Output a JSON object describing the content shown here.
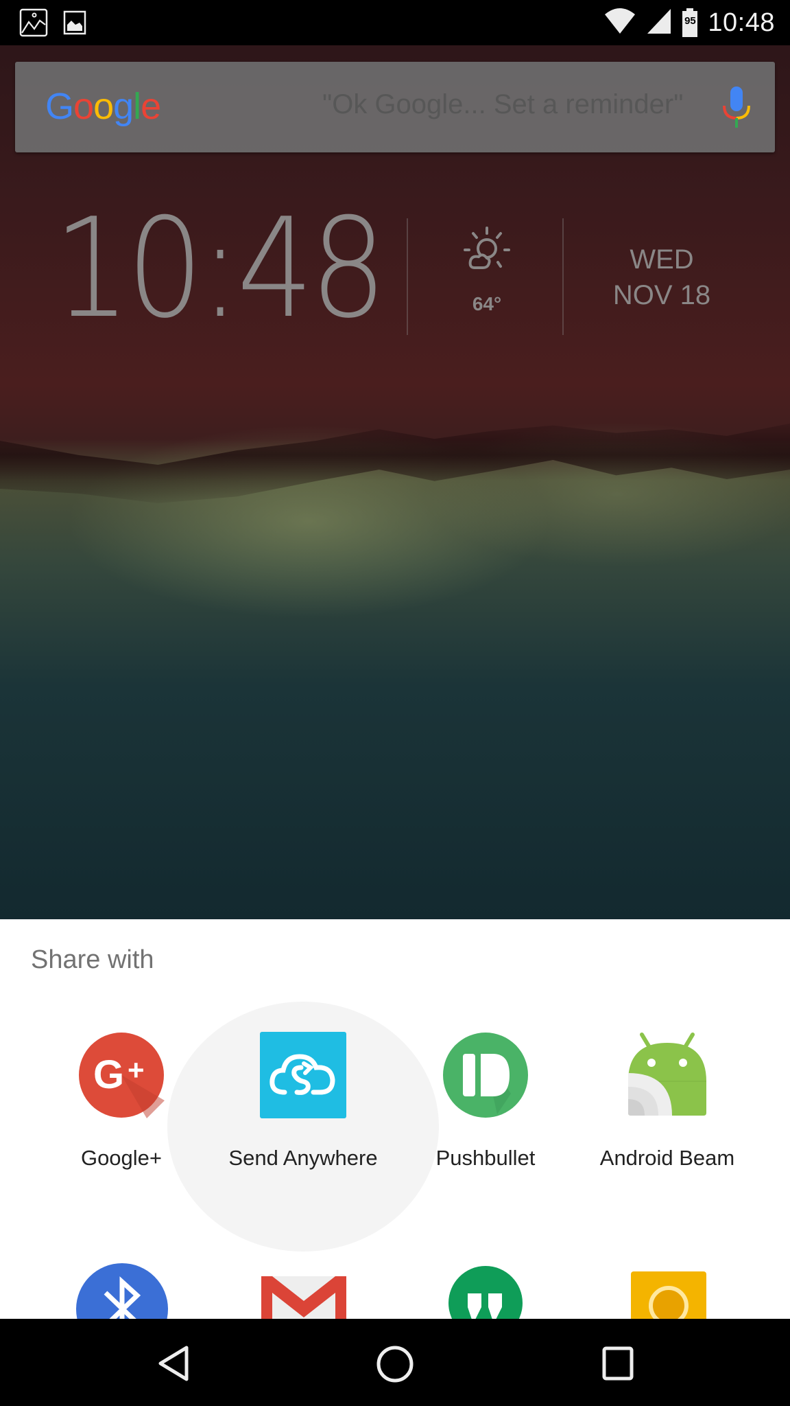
{
  "status_bar": {
    "left_icons": [
      "gallery-notification-icon",
      "image-notification-icon"
    ],
    "wifi_icon": "wifi-icon",
    "signal_icon": "cell-signal-icon",
    "battery_level": "95",
    "time": "10:48"
  },
  "search_widget": {
    "logo": "Google",
    "logo_colors": [
      "#4285F4",
      "#EA4335",
      "#FBBC05",
      "#4285F4",
      "#34A853",
      "#EA4335"
    ],
    "hint": "\"Ok Google... Set a reminder\"",
    "mic_icon": "microphone-icon"
  },
  "clock_widget": {
    "time": "10:48",
    "weather_icon": "partly-sunny-icon",
    "temperature": "64°",
    "day": "WED",
    "date": "NOV 18"
  },
  "share_sheet": {
    "title": "Share with",
    "apps": [
      {
        "label": "Google+",
        "icon": "google-plus-icon",
        "color": "#DD4B39"
      },
      {
        "label": "Send Anywhere",
        "icon": "send-anywhere-icon",
        "color": "#1FBDE3"
      },
      {
        "label": "Pushbullet",
        "icon": "pushbullet-icon",
        "color": "#4AB367"
      },
      {
        "label": "Android Beam",
        "icon": "android-beam-icon",
        "color": "#8BC34A"
      }
    ],
    "partial_apps": [
      {
        "icon": "bluetooth-icon",
        "color": "#3B6FD6"
      },
      {
        "icon": "gmail-icon",
        "color": "#DB4437"
      },
      {
        "icon": "hangouts-icon",
        "color": "#0F9D58"
      },
      {
        "icon": "keep-icon",
        "color": "#F4B400"
      }
    ]
  },
  "nav_bar": {
    "back": "back-icon",
    "home": "home-icon",
    "recents": "recents-icon"
  }
}
